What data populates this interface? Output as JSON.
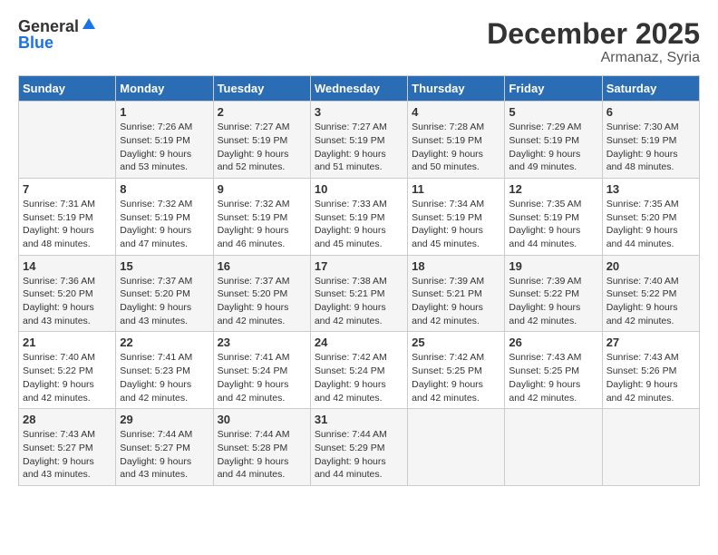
{
  "header": {
    "logo_general": "General",
    "logo_blue": "Blue",
    "month": "December 2025",
    "location": "Armanaz, Syria"
  },
  "days_of_week": [
    "Sunday",
    "Monday",
    "Tuesday",
    "Wednesday",
    "Thursday",
    "Friday",
    "Saturday"
  ],
  "weeks": [
    [
      {
        "day": "",
        "sunrise": "",
        "sunset": "",
        "daylight": ""
      },
      {
        "day": "1",
        "sunrise": "Sunrise: 7:26 AM",
        "sunset": "Sunset: 5:19 PM",
        "daylight": "Daylight: 9 hours and 53 minutes."
      },
      {
        "day": "2",
        "sunrise": "Sunrise: 7:27 AM",
        "sunset": "Sunset: 5:19 PM",
        "daylight": "Daylight: 9 hours and 52 minutes."
      },
      {
        "day": "3",
        "sunrise": "Sunrise: 7:27 AM",
        "sunset": "Sunset: 5:19 PM",
        "daylight": "Daylight: 9 hours and 51 minutes."
      },
      {
        "day": "4",
        "sunrise": "Sunrise: 7:28 AM",
        "sunset": "Sunset: 5:19 PM",
        "daylight": "Daylight: 9 hours and 50 minutes."
      },
      {
        "day": "5",
        "sunrise": "Sunrise: 7:29 AM",
        "sunset": "Sunset: 5:19 PM",
        "daylight": "Daylight: 9 hours and 49 minutes."
      },
      {
        "day": "6",
        "sunrise": "Sunrise: 7:30 AM",
        "sunset": "Sunset: 5:19 PM",
        "daylight": "Daylight: 9 hours and 48 minutes."
      }
    ],
    [
      {
        "day": "7",
        "sunrise": "Sunrise: 7:31 AM",
        "sunset": "Sunset: 5:19 PM",
        "daylight": "Daylight: 9 hours and 48 minutes."
      },
      {
        "day": "8",
        "sunrise": "Sunrise: 7:32 AM",
        "sunset": "Sunset: 5:19 PM",
        "daylight": "Daylight: 9 hours and 47 minutes."
      },
      {
        "day": "9",
        "sunrise": "Sunrise: 7:32 AM",
        "sunset": "Sunset: 5:19 PM",
        "daylight": "Daylight: 9 hours and 46 minutes."
      },
      {
        "day": "10",
        "sunrise": "Sunrise: 7:33 AM",
        "sunset": "Sunset: 5:19 PM",
        "daylight": "Daylight: 9 hours and 45 minutes."
      },
      {
        "day": "11",
        "sunrise": "Sunrise: 7:34 AM",
        "sunset": "Sunset: 5:19 PM",
        "daylight": "Daylight: 9 hours and 45 minutes."
      },
      {
        "day": "12",
        "sunrise": "Sunrise: 7:35 AM",
        "sunset": "Sunset: 5:19 PM",
        "daylight": "Daylight: 9 hours and 44 minutes."
      },
      {
        "day": "13",
        "sunrise": "Sunrise: 7:35 AM",
        "sunset": "Sunset: 5:20 PM",
        "daylight": "Daylight: 9 hours and 44 minutes."
      }
    ],
    [
      {
        "day": "14",
        "sunrise": "Sunrise: 7:36 AM",
        "sunset": "Sunset: 5:20 PM",
        "daylight": "Daylight: 9 hours and 43 minutes."
      },
      {
        "day": "15",
        "sunrise": "Sunrise: 7:37 AM",
        "sunset": "Sunset: 5:20 PM",
        "daylight": "Daylight: 9 hours and 43 minutes."
      },
      {
        "day": "16",
        "sunrise": "Sunrise: 7:37 AM",
        "sunset": "Sunset: 5:20 PM",
        "daylight": "Daylight: 9 hours and 42 minutes."
      },
      {
        "day": "17",
        "sunrise": "Sunrise: 7:38 AM",
        "sunset": "Sunset: 5:21 PM",
        "daylight": "Daylight: 9 hours and 42 minutes."
      },
      {
        "day": "18",
        "sunrise": "Sunrise: 7:39 AM",
        "sunset": "Sunset: 5:21 PM",
        "daylight": "Daylight: 9 hours and 42 minutes."
      },
      {
        "day": "19",
        "sunrise": "Sunrise: 7:39 AM",
        "sunset": "Sunset: 5:22 PM",
        "daylight": "Daylight: 9 hours and 42 minutes."
      },
      {
        "day": "20",
        "sunrise": "Sunrise: 7:40 AM",
        "sunset": "Sunset: 5:22 PM",
        "daylight": "Daylight: 9 hours and 42 minutes."
      }
    ],
    [
      {
        "day": "21",
        "sunrise": "Sunrise: 7:40 AM",
        "sunset": "Sunset: 5:22 PM",
        "daylight": "Daylight: 9 hours and 42 minutes."
      },
      {
        "day": "22",
        "sunrise": "Sunrise: 7:41 AM",
        "sunset": "Sunset: 5:23 PM",
        "daylight": "Daylight: 9 hours and 42 minutes."
      },
      {
        "day": "23",
        "sunrise": "Sunrise: 7:41 AM",
        "sunset": "Sunset: 5:24 PM",
        "daylight": "Daylight: 9 hours and 42 minutes."
      },
      {
        "day": "24",
        "sunrise": "Sunrise: 7:42 AM",
        "sunset": "Sunset: 5:24 PM",
        "daylight": "Daylight: 9 hours and 42 minutes."
      },
      {
        "day": "25",
        "sunrise": "Sunrise: 7:42 AM",
        "sunset": "Sunset: 5:25 PM",
        "daylight": "Daylight: 9 hours and 42 minutes."
      },
      {
        "day": "26",
        "sunrise": "Sunrise: 7:43 AM",
        "sunset": "Sunset: 5:25 PM",
        "daylight": "Daylight: 9 hours and 42 minutes."
      },
      {
        "day": "27",
        "sunrise": "Sunrise: 7:43 AM",
        "sunset": "Sunset: 5:26 PM",
        "daylight": "Daylight: 9 hours and 42 minutes."
      }
    ],
    [
      {
        "day": "28",
        "sunrise": "Sunrise: 7:43 AM",
        "sunset": "Sunset: 5:27 PM",
        "daylight": "Daylight: 9 hours and 43 minutes."
      },
      {
        "day": "29",
        "sunrise": "Sunrise: 7:44 AM",
        "sunset": "Sunset: 5:27 PM",
        "daylight": "Daylight: 9 hours and 43 minutes."
      },
      {
        "day": "30",
        "sunrise": "Sunrise: 7:44 AM",
        "sunset": "Sunset: 5:28 PM",
        "daylight": "Daylight: 9 hours and 44 minutes."
      },
      {
        "day": "31",
        "sunrise": "Sunrise: 7:44 AM",
        "sunset": "Sunset: 5:29 PM",
        "daylight": "Daylight: 9 hours and 44 minutes."
      },
      {
        "day": "",
        "sunrise": "",
        "sunset": "",
        "daylight": ""
      },
      {
        "day": "",
        "sunrise": "",
        "sunset": "",
        "daylight": ""
      },
      {
        "day": "",
        "sunrise": "",
        "sunset": "",
        "daylight": ""
      }
    ]
  ]
}
